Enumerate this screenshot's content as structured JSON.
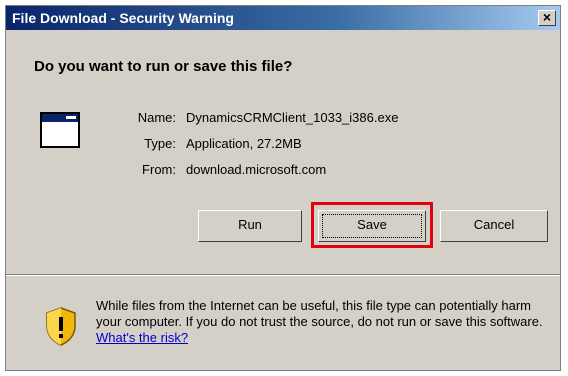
{
  "window": {
    "title": "File Download - Security Warning",
    "close_glyph": "×"
  },
  "question": "Do you want to run or save this file?",
  "file": {
    "name_label": "Name:",
    "name_value": "DynamicsCRMClient_1033_i386.exe",
    "type_label": "Type:",
    "type_value": "Application, 27.2MB",
    "from_label": "From:",
    "from_value": "download.microsoft.com",
    "icon": "application-window-icon"
  },
  "buttons": {
    "run": "Run",
    "save": "Save",
    "cancel": "Cancel"
  },
  "warning": {
    "text": "While files from the Internet can be useful, this file type can potentially harm your computer. If you do not trust the source, do not run or save this software. ",
    "link": "What's the risk?",
    "icon": "security-shield-icon"
  },
  "colors": {
    "highlight": "#e3000f",
    "titlebar": "#0a246a",
    "dialog_bg": "#d4d0c8",
    "link": "#0000cc"
  }
}
